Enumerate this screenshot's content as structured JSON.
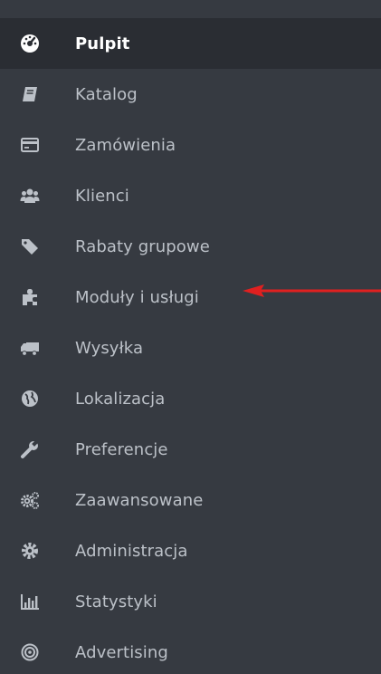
{
  "sidebar": {
    "items": [
      {
        "label": "Pulpit",
        "icon": "dashboard-icon",
        "active": true
      },
      {
        "label": "Katalog",
        "icon": "book-icon"
      },
      {
        "label": "Zamówienia",
        "icon": "credit-card-icon"
      },
      {
        "label": "Klienci",
        "icon": "users-icon"
      },
      {
        "label": "Rabaty grupowe",
        "icon": "tag-icon"
      },
      {
        "label": "Moduły i usługi",
        "icon": "puzzle-icon"
      },
      {
        "label": "Wysyłka",
        "icon": "truck-icon"
      },
      {
        "label": "Lokalizacja",
        "icon": "globe-icon"
      },
      {
        "label": "Preferencje",
        "icon": "wrench-icon"
      },
      {
        "label": "Zaawansowane",
        "icon": "cogs-icon"
      },
      {
        "label": "Administracja",
        "icon": "cog-icon"
      },
      {
        "label": "Statystyki",
        "icon": "bar-chart-icon"
      },
      {
        "label": "Advertising",
        "icon": "bullseye-icon"
      }
    ]
  },
  "colors": {
    "sidebar_bg": "#363a41",
    "active_bg": "#2a2d33",
    "text": "#bcc1c8",
    "active_text": "#ffffff",
    "icon": "#bcc1c8",
    "arrow": "#e02020"
  },
  "annotation": {
    "icon": "red-arrow-icon",
    "points_to": "Moduły i usługi"
  }
}
